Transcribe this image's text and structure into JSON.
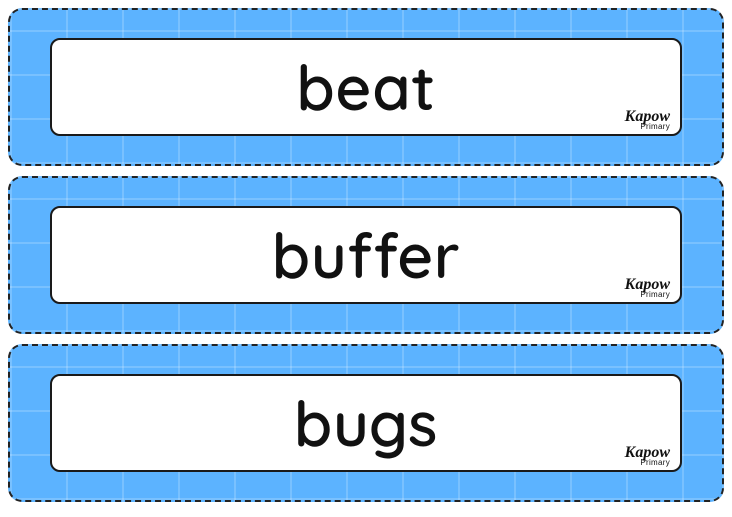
{
  "brand": {
    "name": "Kapow",
    "sub": "Primary"
  },
  "cards": [
    {
      "word": "beat"
    },
    {
      "word": "buffer"
    },
    {
      "word": "bugs"
    }
  ]
}
